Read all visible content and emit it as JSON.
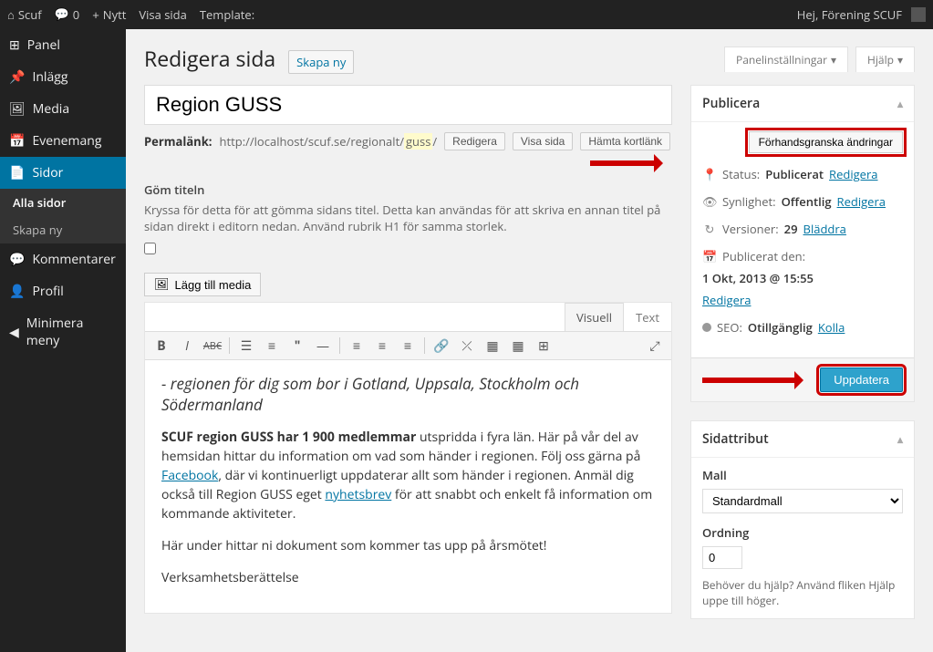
{
  "topbar": {
    "site_name": "Scuf",
    "comments_count": "0",
    "new_label": "Nytt",
    "view_label": "Visa sida",
    "template_label": "Template:",
    "greeting": "Hej, Förening SCUF"
  },
  "sidebar": {
    "items": [
      {
        "label": "Panel",
        "icon": "⌂"
      },
      {
        "label": "Inlägg",
        "icon": "📌"
      },
      {
        "label": "Media",
        "icon": "🎵"
      },
      {
        "label": "Evenemang",
        "icon": "📅"
      },
      {
        "label": "Sidor",
        "icon": "📄"
      },
      {
        "label": "Kommentarer",
        "icon": "💬"
      },
      {
        "label": "Profil",
        "icon": "👤"
      },
      {
        "label": "Minimera meny",
        "icon": "◀"
      }
    ],
    "submenu": {
      "all": "Alla sidor",
      "new": "Skapa ny"
    }
  },
  "header": {
    "title": "Redigera sida",
    "add_new": "Skapa ny",
    "screen_options": "Panelinställningar",
    "help": "Hjälp"
  },
  "editor": {
    "title_value": "Region GUSS",
    "permalink_label": "Permalänk:",
    "permalink_base": "http://localhost/scuf.se/regionalt/",
    "permalink_slug": "guss",
    "permalink_trail": "/",
    "btn_edit": "Redigera",
    "btn_view": "Visa sida",
    "btn_shortlink": "Hämta kortlänk",
    "hide_title_heading": "Göm titeln",
    "hide_title_desc": "Kryssa för detta för att gömma sidans titel. Detta kan användas för att skriva en annan titel på sidan direkt i editorn nedan. Använd rubrik H1 för samma storlek.",
    "add_media": "Lägg till media",
    "tab_visual": "Visuell",
    "tab_text": "Text",
    "content_lead": "- regionen för dig som bor i Gotland, Uppsala, Stockholm och Södermanland",
    "para1_a": "SCUF region GUSS har 1 900 medlemmar",
    "para1_b": " utspridda i fyra län. Här på vår del av hemsidan hittar du information om vad som händer i regionen. Följ oss gärna på ",
    "para1_link1": "Facebook",
    "para1_c": ", där vi kontinuerligt uppdaterar allt som händer i regionen. Anmäl dig också till Region GUSS eget ",
    "para1_link2": "nyhetsbrev",
    "para1_d": " för att snabbt och enkelt få information om kommande aktiviteter.",
    "para2": "Här under hittar ni dokument som kommer tas upp på årsmötet!",
    "para3": "Verksamhetsberättelse"
  },
  "publish": {
    "box_title": "Publicera",
    "preview_btn": "Förhandsgranska ändringar",
    "status_label": "Status:",
    "status_value": "Publicerat",
    "status_edit": "Redigera",
    "visibility_label": "Synlighet:",
    "visibility_value": "Offentlig",
    "visibility_edit": "Redigera",
    "revisions_label": "Versioner:",
    "revisions_value": "29",
    "revisions_browse": "Bläddra",
    "date_label": "Publicerat den:",
    "date_value": "1 Okt, 2013 @ 15:55",
    "date_edit": "Redigera",
    "seo_label": "SEO:",
    "seo_value": "Otillgänglig",
    "seo_check": "Kolla",
    "update_btn": "Uppdatera"
  },
  "attributes": {
    "box_title": "Sidattribut",
    "template_label": "Mall",
    "template_value": "Standardmall",
    "order_label": "Ordning",
    "order_value": "0",
    "help_text": "Behöver du hjälp? Använd fliken Hjälp uppe till höger."
  }
}
